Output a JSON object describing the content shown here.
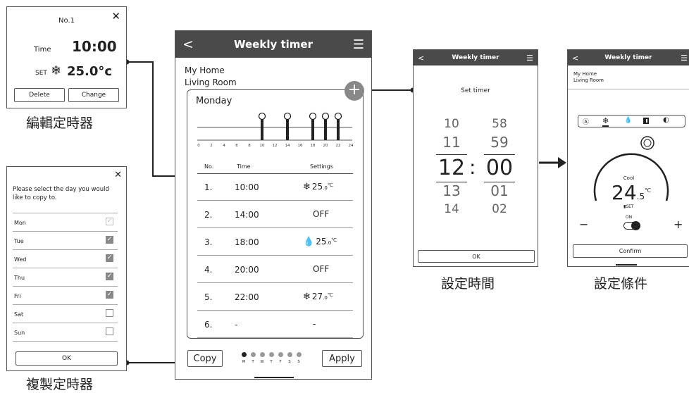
{
  "edit_panel": {
    "title": "No.1",
    "time_label": "Time",
    "time_value": "10:00",
    "set_label": "SET",
    "temp_value": "25.0°c",
    "delete_label": "Delete",
    "change_label": "Change",
    "caption": "編輯定時器"
  },
  "copy_panel": {
    "prompt": "Please select the day you would like to copy to.",
    "days": [
      {
        "label": "Mon",
        "state": "disabled"
      },
      {
        "label": "Tue",
        "state": "checked"
      },
      {
        "label": "Wed",
        "state": "checked"
      },
      {
        "label": "Thu",
        "state": "checked"
      },
      {
        "label": "Fri",
        "state": "checked"
      },
      {
        "label": "Sat",
        "state": "unchecked"
      },
      {
        "label": "Sun",
        "state": "unchecked"
      }
    ],
    "ok_label": "OK",
    "caption": "複製定時器"
  },
  "main_panel": {
    "title": "Weekly timer",
    "home": "My Home",
    "room": "Living Room",
    "day": "Monday",
    "hour_ticks": [
      "0",
      "2",
      "4",
      "6",
      "8",
      "10",
      "12",
      "14",
      "16",
      "18",
      "20",
      "22",
      "24"
    ],
    "timer_hours": [
      10,
      14,
      18,
      20,
      22
    ],
    "col_no": "No.",
    "col_time": "Time",
    "col_settings": "Settings",
    "rows": [
      {
        "no": "1.",
        "time": "10:00",
        "icon": "snowflake",
        "temp": "25",
        "dec": ".0",
        "unit": "℃",
        "text": ""
      },
      {
        "no": "2.",
        "time": "14:00",
        "icon": "",
        "temp": "",
        "dec": "",
        "unit": "",
        "text": "OFF"
      },
      {
        "no": "3.",
        "time": "18:00",
        "icon": "drop",
        "temp": "25",
        "dec": ".0",
        "unit": "℃",
        "text": ""
      },
      {
        "no": "4.",
        "time": "20:00",
        "icon": "",
        "temp": "",
        "dec": "",
        "unit": "",
        "text": "OFF"
      },
      {
        "no": "5.",
        "time": "22:00",
        "icon": "snowflake",
        "temp": "27",
        "dec": ".0",
        "unit": "℃",
        "text": ""
      },
      {
        "no": "6.",
        "time": "-",
        "icon": "",
        "temp": "",
        "dec": "",
        "unit": "",
        "text": "-"
      }
    ],
    "copy_label": "Copy",
    "apply_label": "Apply",
    "day_letters": [
      "M",
      "T",
      "W",
      "T",
      "F",
      "S",
      "S"
    ]
  },
  "set_timer_panel": {
    "title": "Weekly timer",
    "subtitle": "Set timer",
    "hours": [
      "10",
      "11",
      "12",
      "13",
      "14"
    ],
    "minutes": [
      "58",
      "59",
      "00",
      "01",
      "02"
    ],
    "colon": ":",
    "ok_label": "OK",
    "caption": "設定時間"
  },
  "condition_panel": {
    "title": "Weekly timer",
    "home": "My Home",
    "room": "Living Room",
    "mode": "Cool",
    "temp_int": "24",
    "temp_dec": ".5",
    "temp_unit": "℃",
    "set_label": "SET",
    "on_label": "ON",
    "minus": "−",
    "plus": "+",
    "confirm_label": "Confirm",
    "caption": "設定條件"
  },
  "colors": {
    "header": "#4a4a4a",
    "accent": "#222222",
    "plus_button": "#888888"
  }
}
